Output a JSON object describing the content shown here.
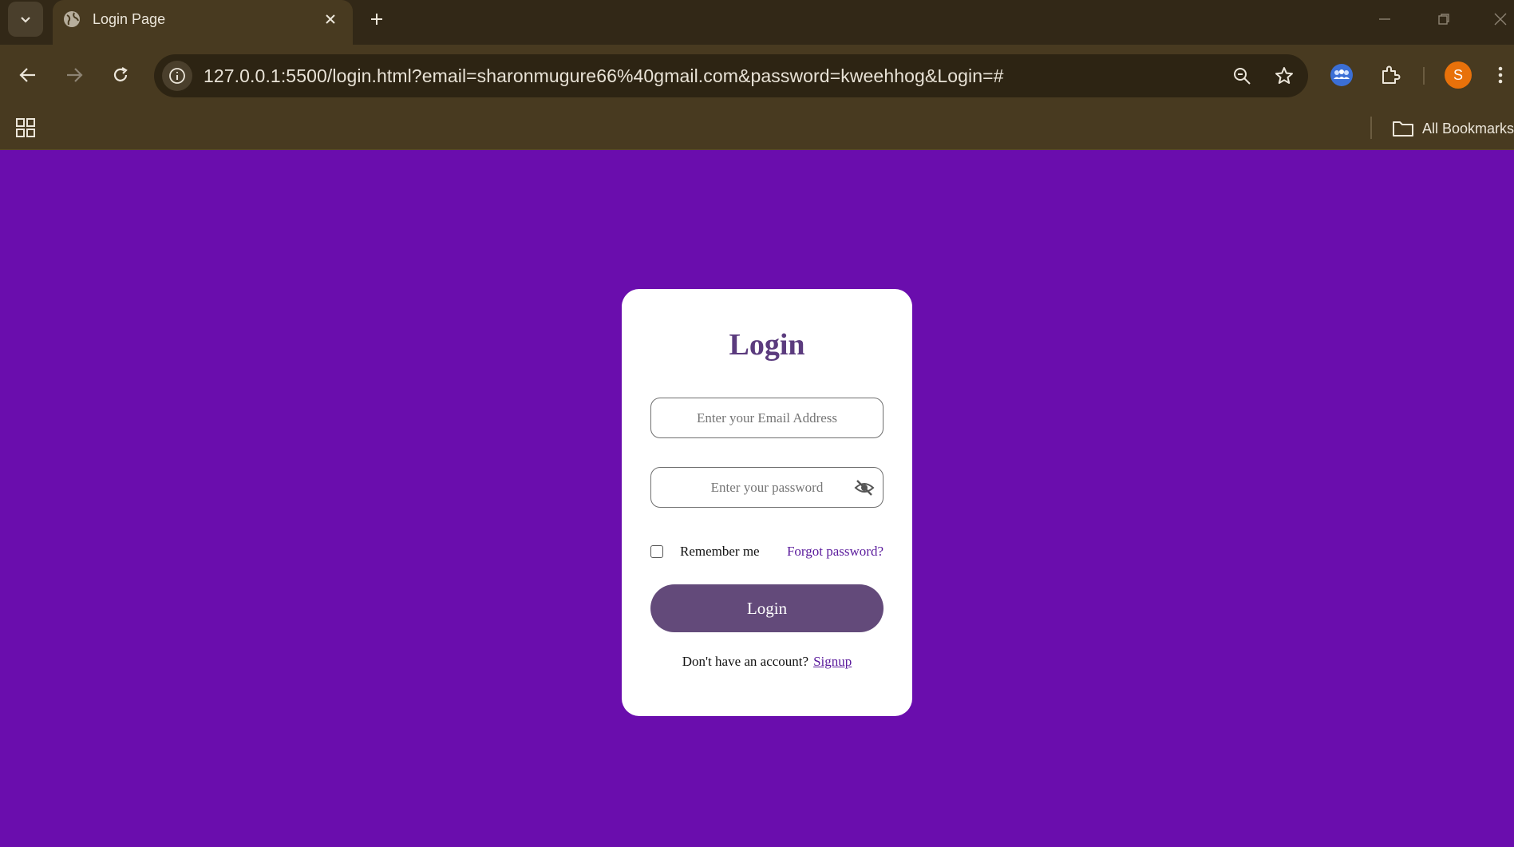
{
  "browser": {
    "tab": {
      "title": "Login Page",
      "icon": "globe-icon"
    },
    "url": "127.0.0.1:5500/login.html?email=sharonmugure66%40gmail.com&password=kweehhog&Login=#",
    "profile_initial": "S",
    "bookmarks_label": "All Bookmarks",
    "colors": {
      "chrome_dark": "#322817",
      "chrome": "#483a20",
      "avatar": "#e8710a"
    }
  },
  "page": {
    "background": "#6a0dad",
    "login_form": {
      "title": "Login",
      "email_placeholder": "Enter your Email Address",
      "email_value": "",
      "password_placeholder": "Enter your password",
      "password_value": "",
      "remember_label": "Remember me",
      "remember_checked": false,
      "forgot_label": "Forgot password?",
      "submit_label": "Login",
      "signup_prompt": "Don't have an account?",
      "signup_label": "Signup",
      "colors": {
        "title": "#5b3b7e",
        "button": "#634a7a",
        "link": "#5a1a9c"
      }
    }
  }
}
